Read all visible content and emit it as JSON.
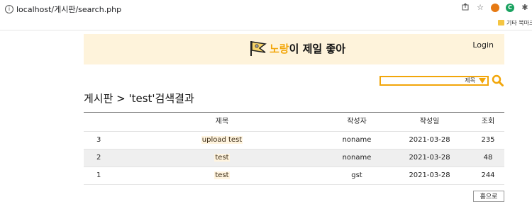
{
  "browser": {
    "url": "localhost/게시판/search.php",
    "info_icon": "i",
    "actions": [
      "share-icon",
      "star-icon",
      "extension-orange-icon",
      "extension-green-icon",
      "puzzle-icon"
    ],
    "ext_green_label": "C",
    "bookmark_label": "기타 북마크"
  },
  "header": {
    "title_accent": "노랑",
    "title_rest": "이 제일 좋아",
    "login_label": "Login",
    "logo": "flag-logo-icon"
  },
  "search": {
    "select_value": "제목"
  },
  "page": {
    "heading": "게시판 > 'test'검색결과"
  },
  "table": {
    "columns": {
      "title": "제목",
      "author": "작성자",
      "date": "작성일",
      "views": "조회"
    },
    "rows": [
      {
        "no": "3",
        "title": "upload test",
        "author": "noname",
        "date": "2021-03-28",
        "views": "235"
      },
      {
        "no": "2",
        "title": "test",
        "author": "noname",
        "date": "2021-03-28",
        "views": "48"
      },
      {
        "no": "1",
        "title": "test",
        "author": "gst",
        "date": "2021-03-28",
        "views": "244"
      }
    ]
  },
  "footer": {
    "home_label": "홈으로"
  },
  "colors": {
    "accent": "#f2a60a",
    "banner_bg": "#fef3db",
    "alt_row": "#efefef"
  }
}
